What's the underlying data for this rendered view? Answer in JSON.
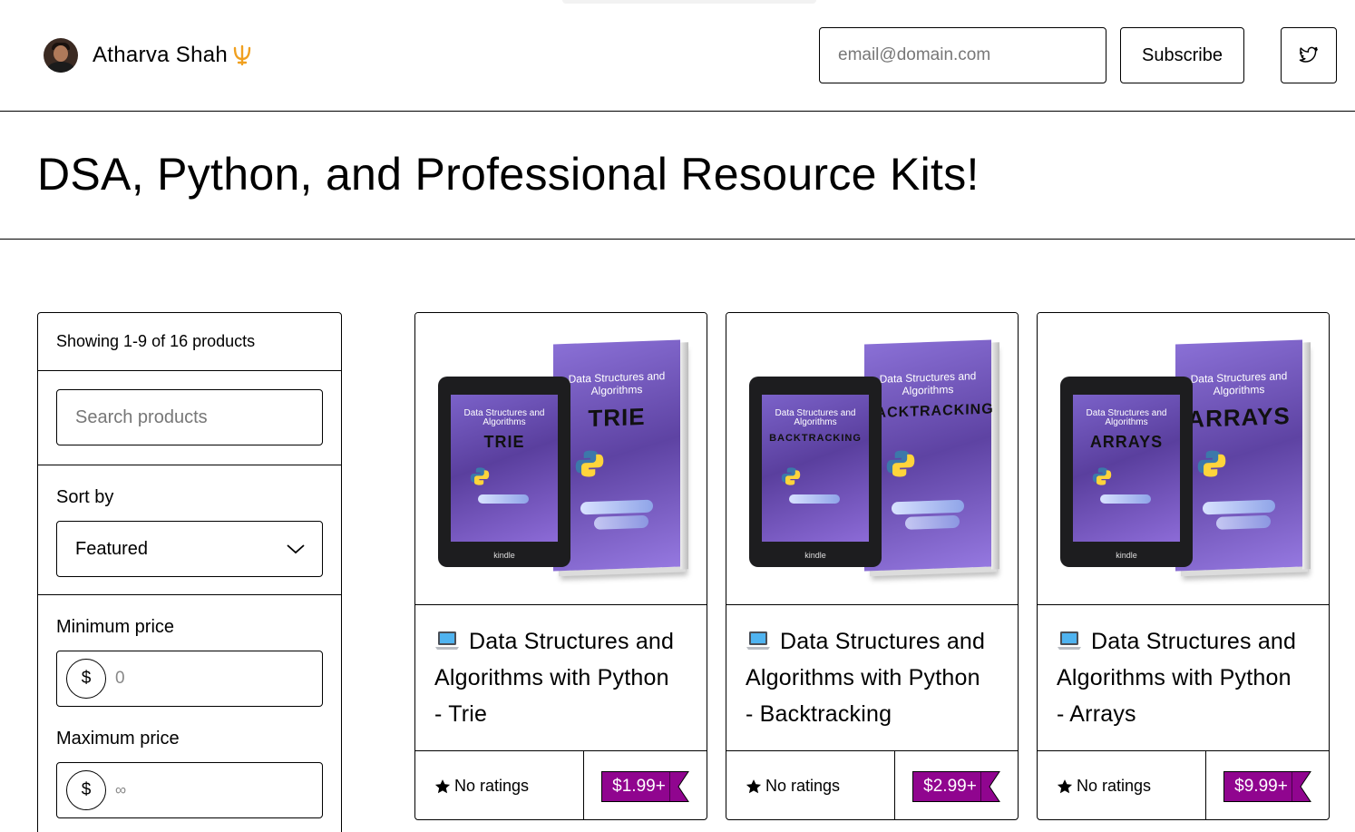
{
  "header": {
    "author_name": "Atharva Shah",
    "email_placeholder": "email@domain.com",
    "subscribe_label": "Subscribe",
    "social_icon": "twitter-icon"
  },
  "page": {
    "title": "DSA, Python, and Professional Resource Kits!"
  },
  "sidebar": {
    "count_text": "Showing 1-9 of 16 products",
    "search_placeholder": "Search products",
    "sort_label": "Sort by",
    "sort_value": "Featured",
    "min_price_label": "Minimum price",
    "min_currency": "$",
    "min_placeholder": "0",
    "max_price_label": "Maximum price",
    "max_currency": "$",
    "max_placeholder": "∞"
  },
  "products": [
    {
      "title_line1": "Data Structures and",
      "title_line2": "Algorithms with Python",
      "title_line3": "- Trie",
      "rating": "No ratings",
      "price": "$1.99+",
      "cover_small": "Data Structures and Algorithms",
      "cover_topic": "TRIE"
    },
    {
      "title_line1": "Data Structures and",
      "title_line2": "Algorithms with Python",
      "title_line3": "- Backtracking",
      "rating": "No ratings",
      "price": "$2.99+",
      "cover_small": "Data Structures and Algorithms",
      "cover_topic": "BACKTRACKING"
    },
    {
      "title_line1": "Data Structures and",
      "title_line2": "Algorithms with Python",
      "title_line3": "- Arrays",
      "rating": "No ratings",
      "price": "$9.99+",
      "cover_small": "Data Structures and Algorithms",
      "cover_topic": "ARRAYS"
    }
  ],
  "device_label": "kindle",
  "colors": {
    "price_tag": "#90058f",
    "trident": "#f0a020",
    "cover_purple": "#6a4fb5"
  },
  "icons": {
    "product_title": "laptop-icon",
    "rating": "star-icon",
    "sort": "chevron-down-icon",
    "brand": "trident-icon"
  }
}
